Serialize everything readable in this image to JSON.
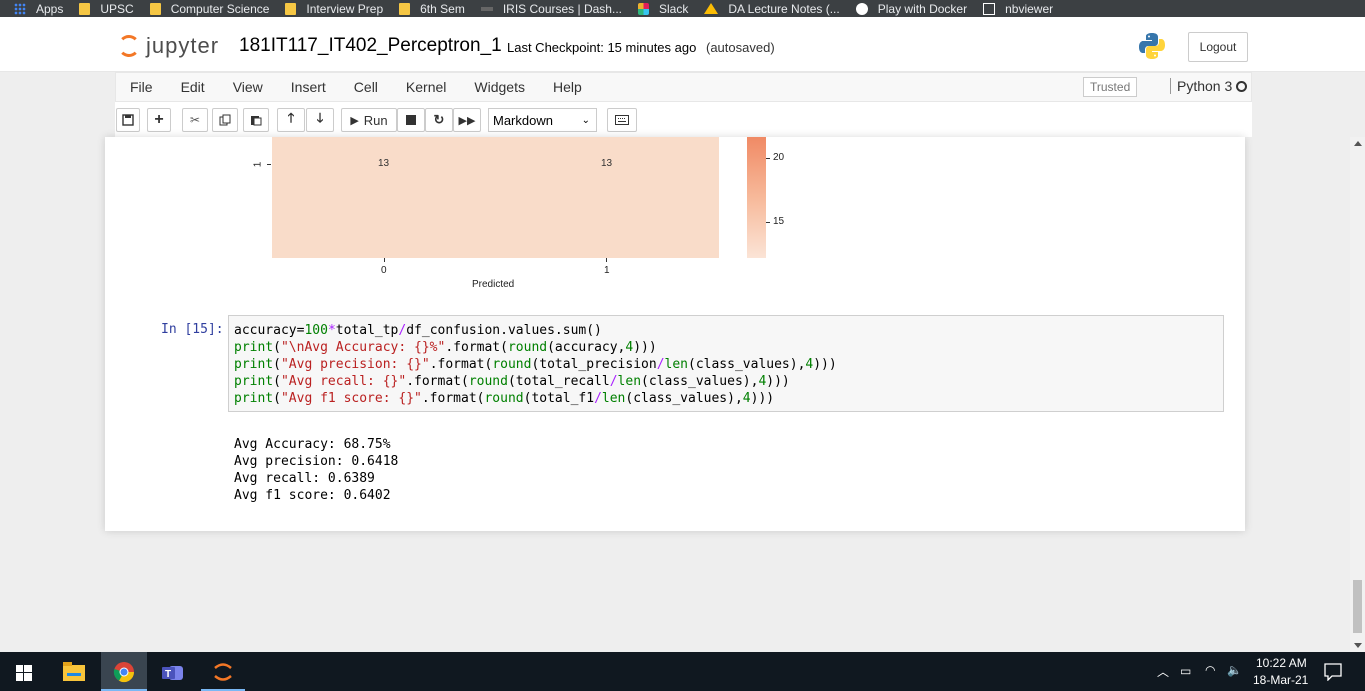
{
  "bookmarks": [
    {
      "label": "Apps",
      "icon": "apps-grid-icon"
    },
    {
      "label": "UPSC",
      "icon": "folder-icon"
    },
    {
      "label": "Computer Science",
      "icon": "folder-icon"
    },
    {
      "label": "Interview Prep",
      "icon": "folder-icon"
    },
    {
      "label": "6th Sem",
      "icon": "folder-icon"
    },
    {
      "label": "IRIS Courses | Dash...",
      "icon": "iris-icon"
    },
    {
      "label": "Slack",
      "icon": "slack-icon"
    },
    {
      "label": "DA Lecture Notes (...",
      "icon": "drive-icon"
    },
    {
      "label": "Play with Docker",
      "icon": "docker-icon"
    },
    {
      "label": "nbviewer",
      "icon": "nbviewer-icon"
    }
  ],
  "header": {
    "logo_text": "jupyter",
    "notebook_name": "181IT117_IT402_Perceptron_1",
    "checkpoint": "Last Checkpoint: 15 minutes ago",
    "autosave": "(autosaved)",
    "logout_label": "Logout"
  },
  "menu": [
    "File",
    "Edit",
    "View",
    "Insert",
    "Cell",
    "Kernel",
    "Widgets",
    "Help"
  ],
  "kernel": {
    "trusted": "Trusted",
    "name": "Python 3"
  },
  "toolbar": {
    "run_label": "Run",
    "cell_type": "Markdown"
  },
  "heatmap": {
    "cells": [
      "13",
      "13"
    ],
    "row_label": "1",
    "x_ticks": [
      "0",
      "1"
    ],
    "xlabel": "Predicted",
    "colorbar_ticks": [
      "20",
      "15"
    ]
  },
  "cell": {
    "prompt": "In [15]:",
    "output": [
      "Avg Accuracy: 68.75%",
      "Avg precision: 0.6418",
      "Avg recall: 0.6389",
      "Avg f1 score: 0.6402"
    ]
  },
  "taskbar": {
    "time": "10:22 AM",
    "date": "18-Mar-21"
  }
}
